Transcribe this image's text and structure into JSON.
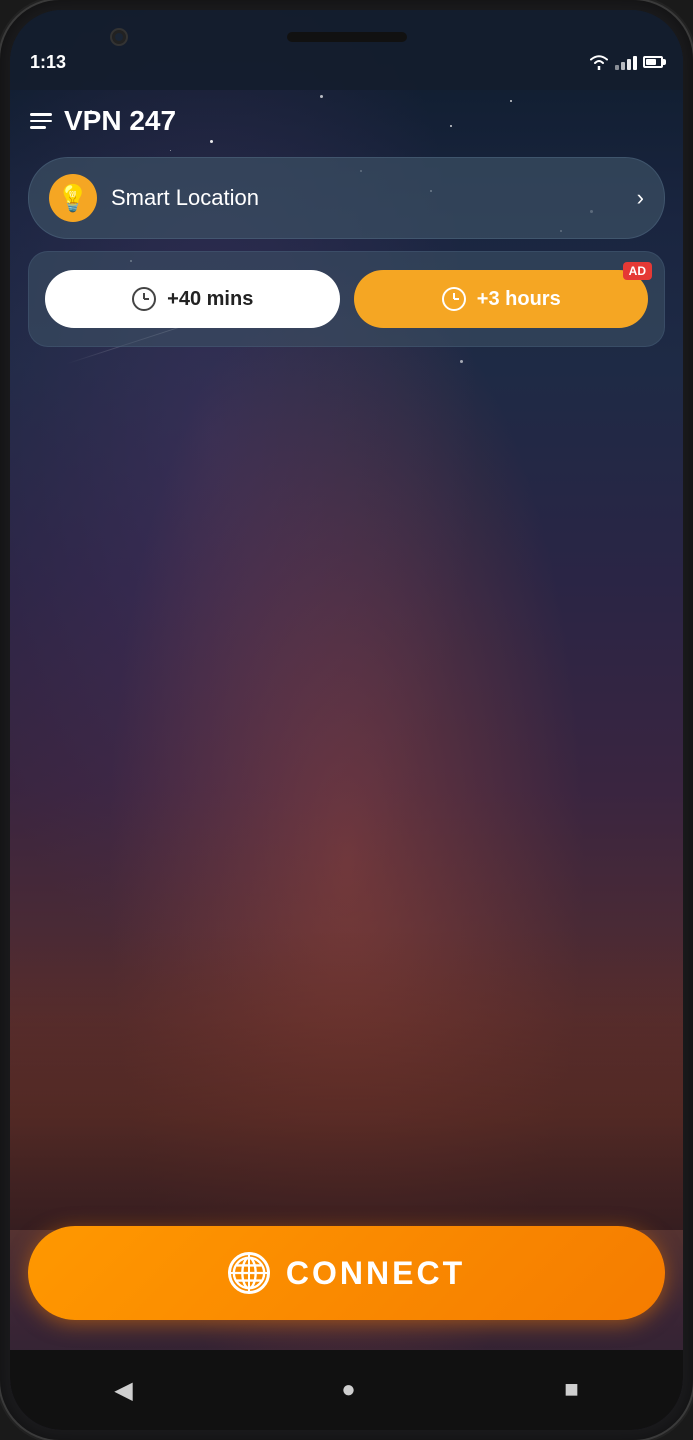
{
  "phone": {
    "status_bar": {
      "time": "1:13",
      "wifi": true,
      "signal_full": true,
      "battery_level": 70
    },
    "app_header": {
      "title": "VPN 247",
      "menu_label": "menu"
    },
    "location": {
      "label": "Smart Location",
      "icon": "💡",
      "arrow": "›"
    },
    "timer": {
      "btn1_label": "+40 mins",
      "btn2_label": "+3 hours",
      "ad_badge": "AD"
    },
    "connect_button": {
      "label": "CONNECT",
      "icon": "globe"
    },
    "bottom_nav": {
      "back_icon": "◀",
      "home_icon": "●",
      "recent_icon": "■"
    }
  }
}
